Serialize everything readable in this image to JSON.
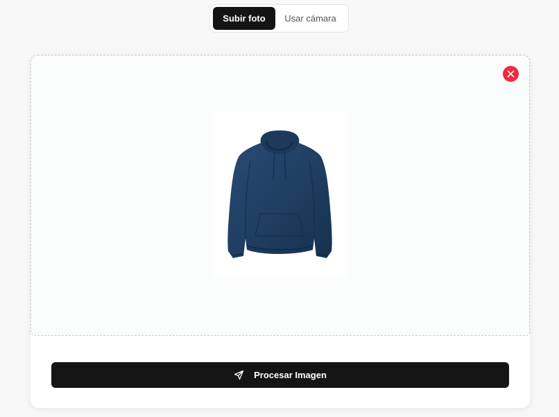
{
  "mode_tabs": {
    "upload_label": "Subir foto",
    "camera_label": "Usar cámara",
    "active": "upload"
  },
  "dropzone": {
    "remove_icon": "close-icon",
    "preview_image": "navy-hoodie",
    "preview_color": "#1f3f62"
  },
  "actions": {
    "process_label": "Procesar Imagen",
    "process_icon": "send-icon"
  },
  "colors": {
    "primary": "#141414",
    "danger": "#f0293e"
  }
}
